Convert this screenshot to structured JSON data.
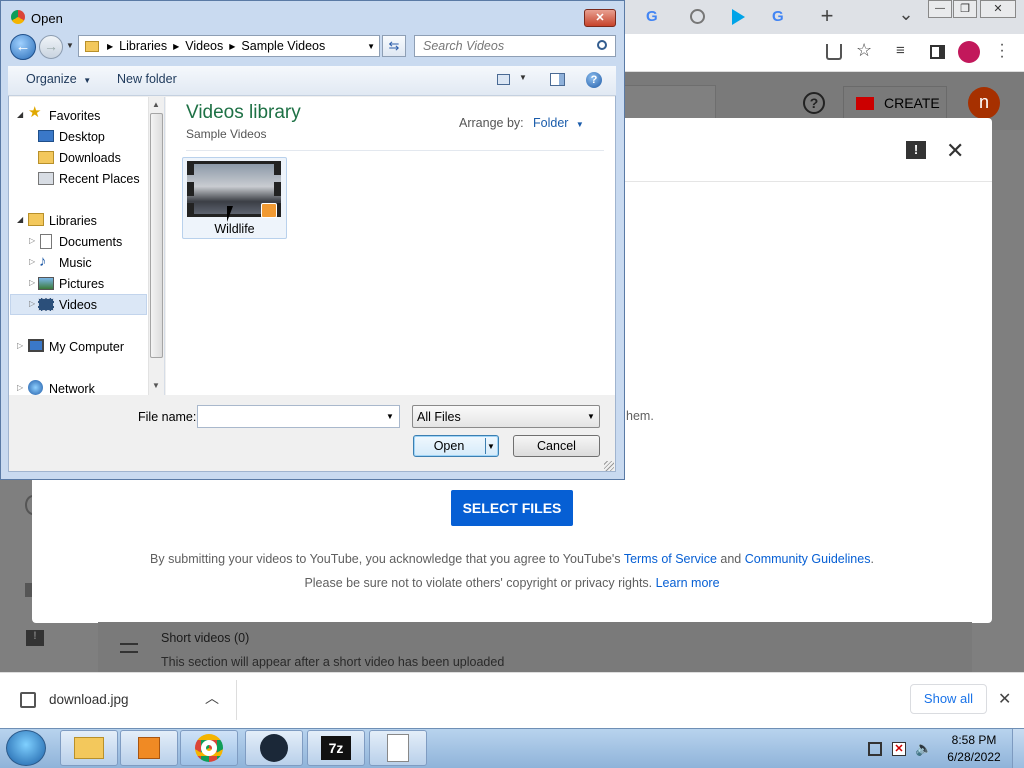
{
  "browser": {
    "tab_glyphs": [
      "G",
      "G",
      "G"
    ],
    "new_tab": "+",
    "tabs_dropdown": "⌄",
    "window_controls": {
      "minimize": "—",
      "maximize": "❐",
      "close": "✕"
    }
  },
  "youtube": {
    "create_label": "CREATE",
    "avatar_letter": "n",
    "select_files_label": "SELECT FILES",
    "legal_line1_pre": "By submitting your videos to YouTube, you acknowledge that you agree to YouTube's ",
    "terms_link": "Terms of Service",
    "legal_and": " and ",
    "guidelines_link": "Community Guidelines",
    "legal_period": ".",
    "legal_line2_pre": "Please be sure not to violate others' copyright or privacy rights. ",
    "learn_more_link": "Learn more",
    "partial_text_them": "hem.",
    "short_videos_title": "Short videos (0)",
    "short_videos_note": "This section will appear after a short video has been uploaded"
  },
  "download_bar": {
    "filename": "download.jpg",
    "show_all": "Show all"
  },
  "taskbar": {
    "time": "8:58 PM",
    "date": "6/28/2022"
  },
  "dialog": {
    "title": "Open",
    "breadcrumb": [
      "Libraries",
      "Videos",
      "Sample Videos"
    ],
    "search_placeholder": "Search Videos",
    "organize": "Organize",
    "new_folder": "New folder",
    "nav": {
      "favorites": "Favorites",
      "desktop": "Desktop",
      "downloads": "Downloads",
      "recent_places": "Recent Places",
      "libraries": "Libraries",
      "documents": "Documents",
      "music": "Music",
      "pictures": "Pictures",
      "videos": "Videos",
      "my_computer": "My Computer",
      "network": "Network"
    },
    "library_title": "Videos library",
    "library_subtitle": "Sample Videos",
    "arrange_by_label": "Arrange by:",
    "arrange_by_value": "Folder",
    "files": [
      {
        "name": "Wildlife"
      }
    ],
    "file_name_label": "File name:",
    "file_name_value": "",
    "file_type": "All Files",
    "open_button": "Open",
    "cancel_button": "Cancel"
  },
  "colors": {
    "youtube_blue": "#065fd4",
    "create_red": "#cc0000",
    "library_green": "#1e7145",
    "link_blue": "#1a5cab"
  }
}
